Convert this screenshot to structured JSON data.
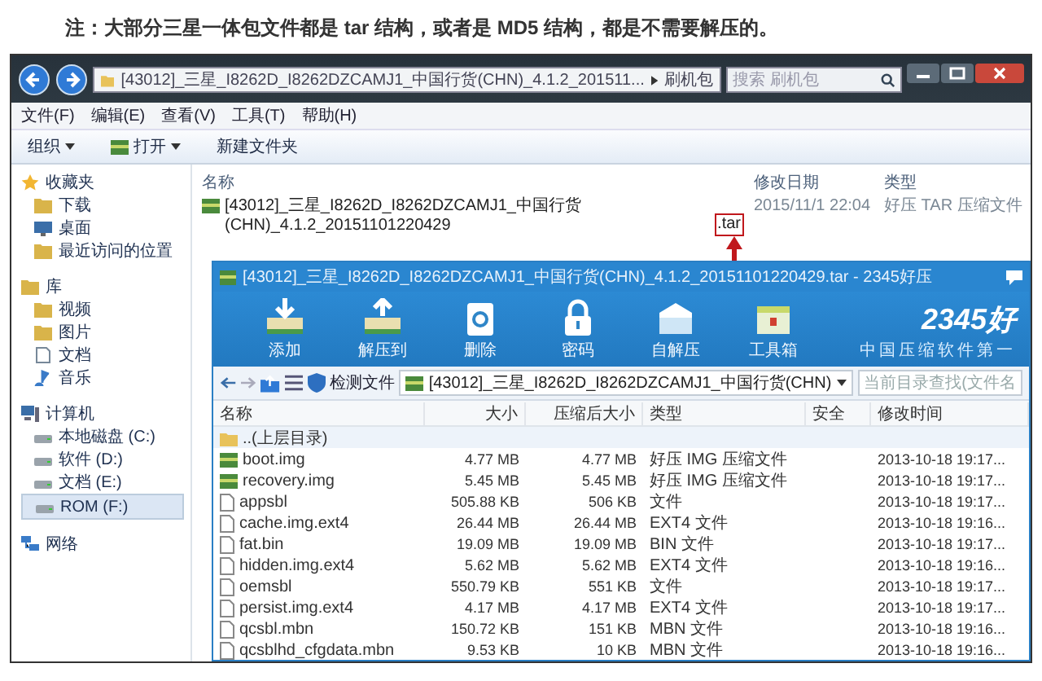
{
  "note": "注：大部分三星一体包文件都是 tar 结构，或者是 MD5 结构，都是不需要解压的。",
  "explorer": {
    "address": [
      "[43012]_三星_I8262D_I8262DZCAMJ1_中国行货(CHN)_4.1.2_201511...",
      "刷机包"
    ],
    "search": {
      "placeholder": "搜索 刷机包"
    },
    "menu": [
      "文件(F)",
      "编辑(E)",
      "查看(V)",
      "工具(T)",
      "帮助(H)"
    ],
    "toolbar": [
      {
        "label": "组织",
        "dropdown": true,
        "kind": "text"
      },
      {
        "label": "打开",
        "dropdown": true,
        "kind": "archive"
      },
      {
        "label": "新建文件夹",
        "dropdown": false,
        "kind": "text"
      }
    ],
    "nav": [
      {
        "label": "收藏夹",
        "kind": "star",
        "items": [
          {
            "label": "下载",
            "kind": "folder",
            "selected": false
          },
          {
            "label": "桌面",
            "kind": "desktop",
            "selected": false
          },
          {
            "label": "最近访问的位置",
            "kind": "folder",
            "selected": false
          }
        ]
      },
      {
        "label": "库",
        "kind": "folder",
        "items": [
          {
            "label": "视频",
            "kind": "folder",
            "selected": false
          },
          {
            "label": "图片",
            "kind": "folder",
            "selected": false
          },
          {
            "label": "文档",
            "kind": "document",
            "selected": false
          },
          {
            "label": "音乐",
            "kind": "music",
            "selected": false
          }
        ]
      },
      {
        "label": "计算机",
        "kind": "computer",
        "items": [
          {
            "label": "本地磁盘 (C:)",
            "kind": "drive",
            "selected": false
          },
          {
            "label": "软件 (D:)",
            "kind": "drive",
            "selected": false
          },
          {
            "label": "文档 (E:)",
            "kind": "drive",
            "selected": false
          },
          {
            "label": "ROM (F:)",
            "kind": "drive",
            "selected": true
          }
        ]
      },
      {
        "label": "网络",
        "kind": "network"
      }
    ],
    "columns": [
      "名称",
      "修改日期",
      "类型"
    ],
    "files": [
      {
        "name": "[43012]_三星_I8262D_I8262DZCAMJ1_中国行货(CHN)_4.1.2_20151101220429",
        "extension": ".tar",
        "highlighted": true,
        "modified": "2015/11/1 22:04",
        "type": "好压 TAR 压缩文件"
      }
    ]
  },
  "archiver": {
    "title": "[43012]_三星_I8262D_I8262DZCAMJ1_中国行货(CHN)_4.1.2_20151101220429.tar - 2345好压",
    "toolbar": [
      {
        "label": "添加",
        "kind": "add"
      },
      {
        "label": "解压到",
        "kind": "extract"
      },
      {
        "label": "删除",
        "kind": "delete"
      },
      {
        "label": "密码",
        "kind": "lock"
      },
      {
        "label": "自解压",
        "kind": "package"
      },
      {
        "label": "工具箱",
        "kind": "toolbox"
      }
    ],
    "logo": "2345好",
    "tagline": "中国压缩软件第一",
    "check_label": "检测文件",
    "archive_path": "[43012]_三星_I8262D_I8262DZCAMJ1_中国行货(CHN)",
    "search": {
      "placeholder": "当前目录查找(文件名"
    },
    "columns": [
      "名称",
      "大小",
      "压缩后大小",
      "类型",
      "安全",
      "修改时间"
    ],
    "rows": [
      {
        "kind": "folder",
        "name": "..(上层目录)"
      },
      {
        "kind": "archive",
        "name": "boot.img",
        "size": "4.77 MB",
        "packed": "4.77 MB",
        "type": "好压 IMG 压缩文件",
        "time": "2013-10-18 19:17..."
      },
      {
        "kind": "archive",
        "name": "recovery.img",
        "size": "5.45 MB",
        "packed": "5.45 MB",
        "type": "好压 IMG 压缩文件",
        "time": "2013-10-18 19:17..."
      },
      {
        "kind": "file",
        "name": "appsbl",
        "size": "505.88 KB",
        "packed": "506 KB",
        "type": "文件",
        "time": "2013-10-18 19:17..."
      },
      {
        "kind": "file",
        "name": "cache.img.ext4",
        "size": "26.44 MB",
        "packed": "26.44 MB",
        "type": "EXT4 文件",
        "time": "2013-10-18 19:16..."
      },
      {
        "kind": "file",
        "name": "fat.bin",
        "size": "19.09 MB",
        "packed": "19.09 MB",
        "type": "BIN 文件",
        "time": "2013-10-18 19:17..."
      },
      {
        "kind": "file",
        "name": "hidden.img.ext4",
        "size": "5.62 MB",
        "packed": "5.62 MB",
        "type": "EXT4 文件",
        "time": "2013-10-18 19:16..."
      },
      {
        "kind": "file",
        "name": "oemsbl",
        "size": "550.79 KB",
        "packed": "551 KB",
        "type": "文件",
        "time": "2013-10-18 19:17..."
      },
      {
        "kind": "file",
        "name": "persist.img.ext4",
        "size": "4.17 MB",
        "packed": "4.17 MB",
        "type": "EXT4 文件",
        "time": "2013-10-18 19:17..."
      },
      {
        "kind": "file",
        "name": "qcsbl.mbn",
        "size": "150.72 KB",
        "packed": "151 KB",
        "type": "MBN 文件",
        "time": "2013-10-18 19:16..."
      },
      {
        "kind": "file",
        "name": "qcsblhd_cfgdata.mbn",
        "size": "9.53 KB",
        "packed": "10 KB",
        "type": "MBN 文件",
        "time": "2013-10-18 19:16..."
      }
    ]
  }
}
